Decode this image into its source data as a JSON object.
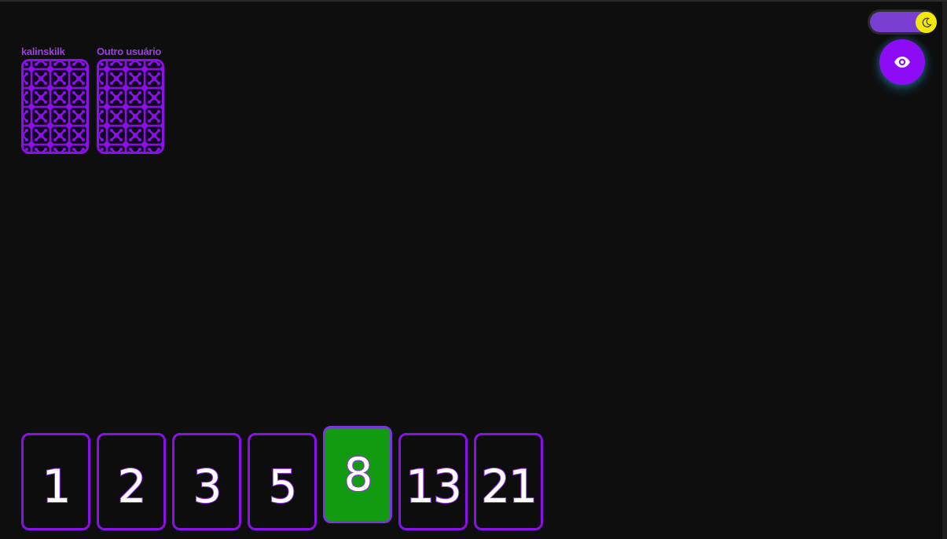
{
  "players": [
    {
      "name": "kalinskilk"
    },
    {
      "name": "Outro usuário"
    }
  ],
  "controls": {
    "theme_icon": "moon-icon",
    "reveal_icon": "eye-icon"
  },
  "deck": {
    "cards": [
      "1",
      "2",
      "3",
      "5",
      "8",
      "13",
      "21"
    ],
    "selected": "8"
  },
  "colors": {
    "background": "#0e0e0e",
    "accent": "#8a10e8",
    "selected_card": "#129a10",
    "toggle_knob": "#f3e80e",
    "toggle_track": "#7a3fd1"
  }
}
